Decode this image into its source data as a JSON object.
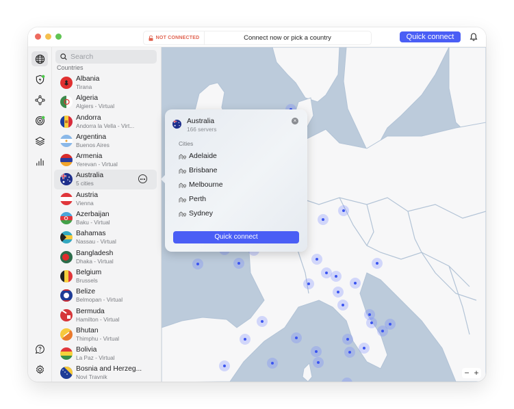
{
  "titlebar": {
    "status": "NOT CONNECTED",
    "prompt": "Connect now or pick a country",
    "quick_connect": "Quick connect",
    "status_color": "#e0624f",
    "accent_color": "#4a5ef5"
  },
  "rail": {
    "icons": [
      "globe-icon",
      "shield-bolt-icon",
      "meshnet-icon",
      "target-icon",
      "layers-icon",
      "stats-icon",
      "help-icon",
      "settings-icon"
    ]
  },
  "panel": {
    "search_placeholder": "Search",
    "section_label": "Countries",
    "countries": [
      {
        "name": "Albania",
        "sub": "Tirana"
      },
      {
        "name": "Algeria",
        "sub": "Algiers - Virtual"
      },
      {
        "name": "Andorra",
        "sub": "Andorra la Vella - Virt..."
      },
      {
        "name": "Argentina",
        "sub": "Buenos Aires"
      },
      {
        "name": "Armenia",
        "sub": "Yerevan - Virtual"
      },
      {
        "name": "Australia",
        "sub": "5 cities",
        "selected": true
      },
      {
        "name": "Austria",
        "sub": "Vienna"
      },
      {
        "name": "Azerbaijan",
        "sub": "Baku - Virtual"
      },
      {
        "name": "Bahamas",
        "sub": "Nassau - Virtual"
      },
      {
        "name": "Bangladesh",
        "sub": "Dhaka - Virtual"
      },
      {
        "name": "Belgium",
        "sub": "Brussels"
      },
      {
        "name": "Belize",
        "sub": "Belmopan - Virtual"
      },
      {
        "name": "Bermuda",
        "sub": "Hamilton - Virtual"
      },
      {
        "name": "Bhutan",
        "sub": "Thimphu - Virtual"
      },
      {
        "name": "Bolivia",
        "sub": "La Paz - Virtual"
      },
      {
        "name": "Bosnia and Herzeg...",
        "sub": "Novi Travnik"
      }
    ]
  },
  "popup": {
    "country": "Australia",
    "servers": "166 servers",
    "cities_label": "Cities",
    "cities": [
      "Adelaide",
      "Brisbane",
      "Melbourne",
      "Perth",
      "Sydney"
    ],
    "quick_connect": "Quick connect"
  },
  "map": {
    "zoom_out": "−",
    "zoom_in": "+"
  }
}
